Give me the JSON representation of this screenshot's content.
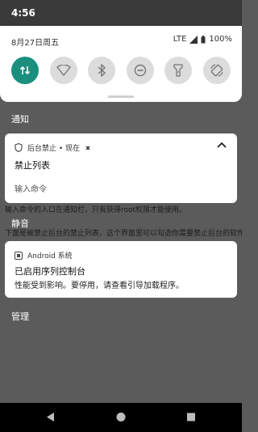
{
  "status_bar": {
    "time": "4:56"
  },
  "quick_settings": {
    "date": "8月27日周五",
    "network": "LTE",
    "battery": "100%",
    "tiles": [
      {
        "name": "data-toggle",
        "icon": "data-arrows-icon",
        "active": true
      },
      {
        "name": "wifi-toggle",
        "icon": "wifi-icon",
        "active": false
      },
      {
        "name": "bluetooth-toggle",
        "icon": "bluetooth-icon",
        "active": false
      },
      {
        "name": "dnd-toggle",
        "icon": "do-not-disturb-icon",
        "active": false
      },
      {
        "name": "flashlight-toggle",
        "icon": "flashlight-icon",
        "active": false
      },
      {
        "name": "autorotate-toggle",
        "icon": "autorotate-icon",
        "active": false
      }
    ]
  },
  "sections": {
    "notifications_title": "通知",
    "silent_title": "静音",
    "manage_label": "管理"
  },
  "notification1": {
    "app": "后台禁止 • 现在",
    "title": "禁止列表",
    "input_placeholder": "输入命令"
  },
  "notification2": {
    "app": "Android 系统",
    "title": "已启用序列控制台",
    "text": "性能受到影响。要停用，请查看引导加载程序。"
  },
  "background_text": {
    "line1": "输入命令的入口在通知栏，只有获得root权限才能使用。",
    "line2": "下面是被禁止后台的禁止列表，这个界面里可以勾选你需要禁止后台的软件"
  },
  "colors": {
    "accent": "#1a8f7e"
  }
}
